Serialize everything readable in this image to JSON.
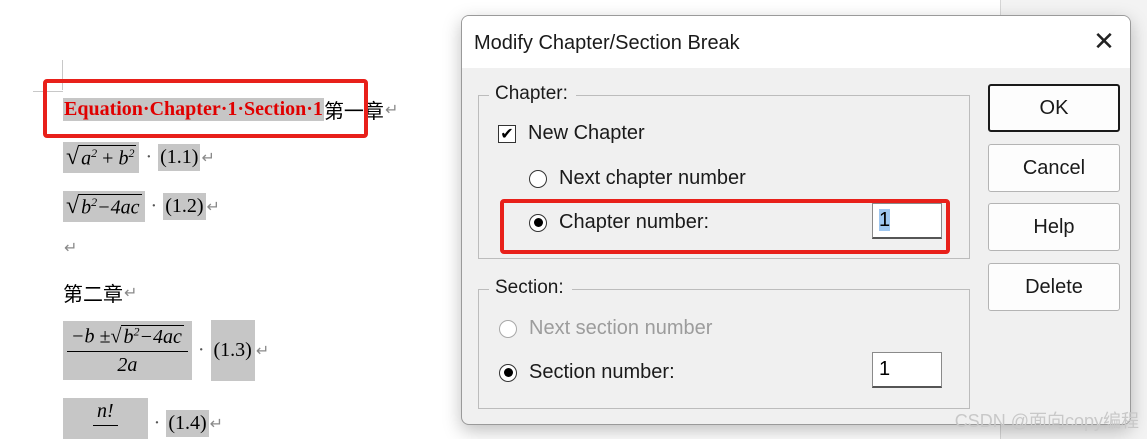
{
  "document": {
    "line1": {
      "field_code": "Equation·Chapter·1·Section·1",
      "heading": "第一章",
      "para_mark": "↵"
    },
    "eq1": {
      "a": "a",
      "a_exp": "2",
      "plus": "+",
      "b": "b",
      "b_exp": "2",
      "number": "(1.1)",
      "para_mark": "↵"
    },
    "eq2": {
      "b": "b",
      "b_exp": "2",
      "rest": "−4ac",
      "number": "(1.2)",
      "para_mark": "↵"
    },
    "empty_para_mark": "↵",
    "heading2": {
      "text": "第二章",
      "para_mark": "↵"
    },
    "eq3": {
      "numerator_prefix": "−b ±",
      "b": "b",
      "b_exp": "2",
      "rest": "−4ac",
      "denominator": "2a",
      "number": "(1.3)",
      "para_mark": "↵"
    },
    "eq4": {
      "numerator": "n!",
      "number": "(1.4)",
      "para_mark": "↵"
    }
  },
  "dialog": {
    "title": "Modify Chapter/Section Break",
    "close_icon": "close-icon",
    "chapter_group": {
      "label": "Chapter:",
      "new_chapter": {
        "label": "New Chapter",
        "checked": true
      },
      "next_chapter_number": {
        "label": "Next chapter number",
        "selected": false
      },
      "chapter_number": {
        "label": "Chapter number:",
        "selected": true,
        "value": "1"
      }
    },
    "section_group": {
      "label": "Section:",
      "next_section_number": {
        "label": "Next section number",
        "selected": false,
        "disabled": true
      },
      "section_number": {
        "label": "Section number:",
        "selected": true,
        "value": "1"
      }
    },
    "buttons": {
      "ok": "OK",
      "cancel": "Cancel",
      "help": "Help",
      "delete": "Delete"
    }
  },
  "watermark": "CSDN @面向copy编程",
  "colors": {
    "highlight_red": "#e8201a",
    "field_text": "#e00000",
    "field_shading": "#c6c6c6",
    "dialog_bg": "#f0f0f0"
  }
}
